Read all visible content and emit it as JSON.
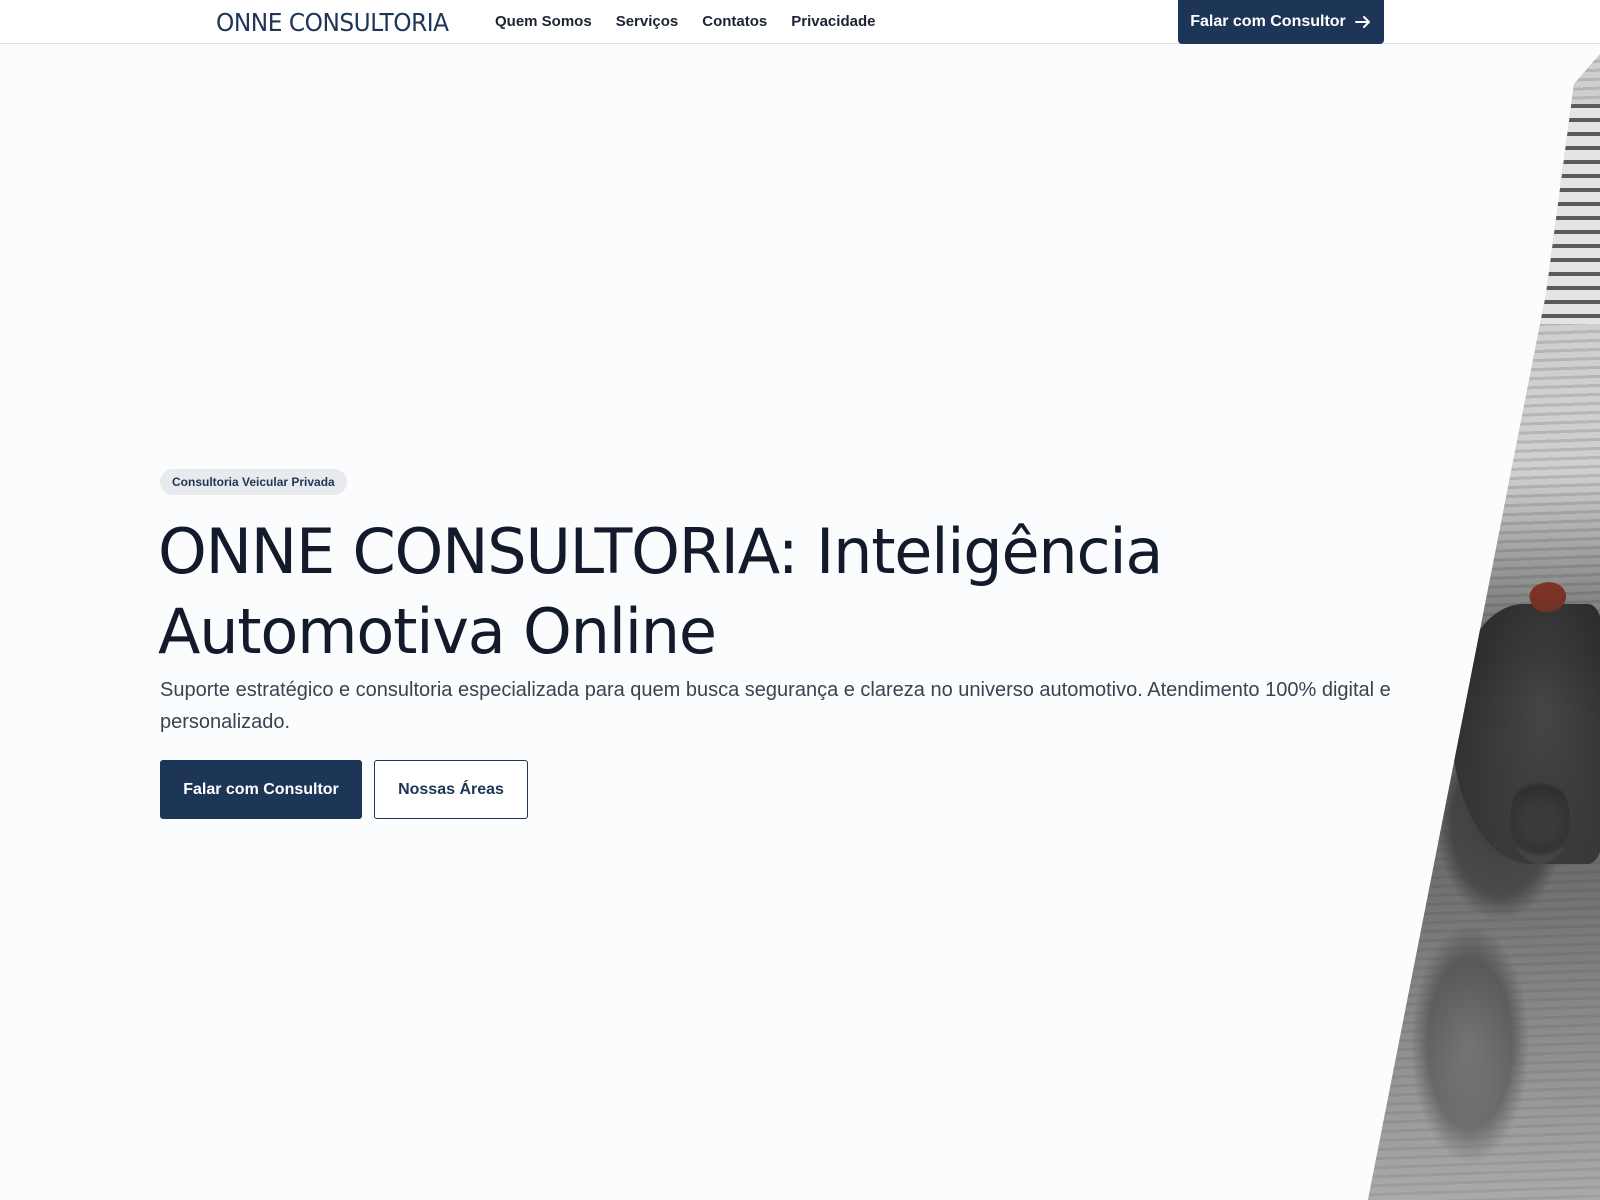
{
  "header": {
    "brand": "ONNE CONSULTORIA",
    "nav": [
      "Quem Somos",
      "Serviços",
      "Contatos",
      "Privacidade"
    ],
    "cta_label": "Falar com Consultor"
  },
  "hero": {
    "badge": "Consultoria Veicular Privada",
    "title": "ONNE CONSULTORIA: Inteligência Automotiva Online",
    "subtitle": "Suporte estratégico e consultoria especializada para quem busca segurança e clareza no universo automotivo. Atendimento 100% digital e personalizado.",
    "primary_button": "Falar com Consultor",
    "secondary_button": "Nossas Áreas"
  },
  "colors": {
    "brand": "#1d3557",
    "background": "#fbfcfd",
    "text": "#121a2b"
  },
  "icons": {
    "header_cta": "arrow-right-icon"
  }
}
